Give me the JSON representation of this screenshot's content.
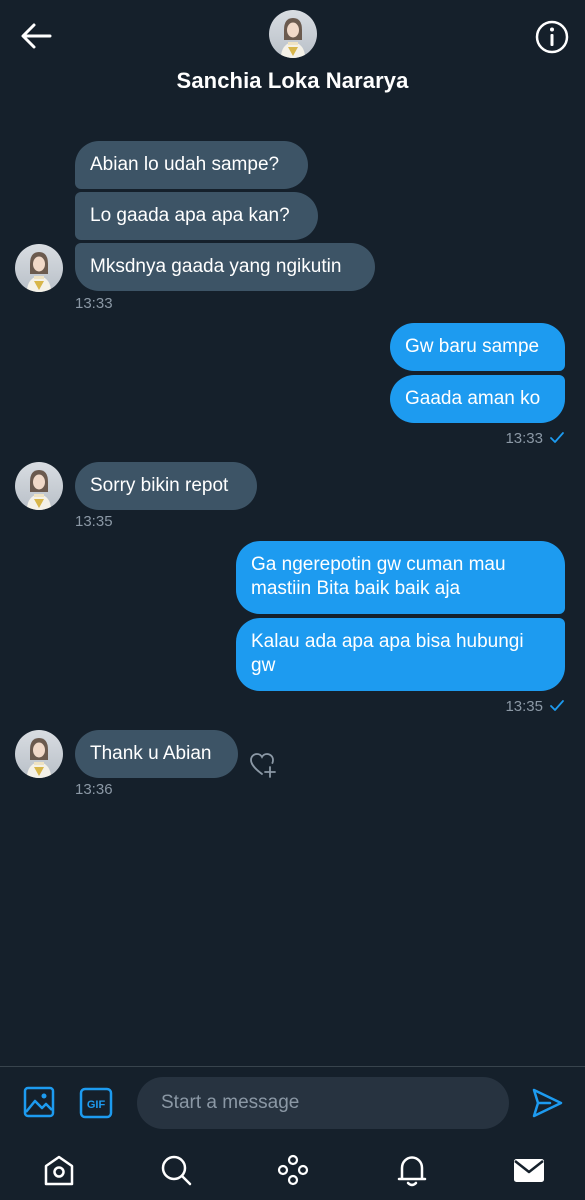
{
  "header": {
    "contact_name": "Sanchia Loka Nararya",
    "back_icon": "arrow-left-icon",
    "info_icon": "info-circle-icon"
  },
  "messages": [
    {
      "direction": "in",
      "text": "Abian lo udah sampe?"
    },
    {
      "direction": "in",
      "text": "Lo gaada apa apa kan?"
    },
    {
      "direction": "in",
      "text": "Mksdnya gaada yang ngikutin",
      "time": "13:33"
    },
    {
      "direction": "out",
      "text": "Gw baru sampe"
    },
    {
      "direction": "out",
      "text": "Gaada aman ko",
      "time": "13:33",
      "status": "sent"
    },
    {
      "direction": "in",
      "text": "Sorry bikin repot",
      "time": "13:35"
    },
    {
      "direction": "out",
      "text": "Ga ngerepotin gw cuman mau mastiin Bita baik baik aja"
    },
    {
      "direction": "out",
      "text": "Kalau ada apa apa bisa hubungi gw",
      "time": "13:35",
      "status": "sent"
    },
    {
      "direction": "in",
      "text": "Thank u Abian",
      "time": "13:36",
      "reaction_icon": "heart-plus-icon"
    }
  ],
  "composer": {
    "placeholder": "Start a message",
    "value": "",
    "media_icon": "image-icon",
    "gif_icon": "gif-icon",
    "gif_label": "GIF",
    "send_icon": "send-icon"
  },
  "navbar": {
    "items": [
      {
        "icon": "home-icon"
      },
      {
        "icon": "search-icon"
      },
      {
        "icon": "spaces-icon"
      },
      {
        "icon": "bell-icon"
      },
      {
        "icon": "mail-icon",
        "active": true
      }
    ]
  },
  "colors": {
    "background": "#15202b",
    "incoming_bubble": "#3d5466",
    "outgoing_bubble": "#1d9bf0",
    "accent": "#1d9bf0",
    "timestamp": "#8b98a5"
  }
}
